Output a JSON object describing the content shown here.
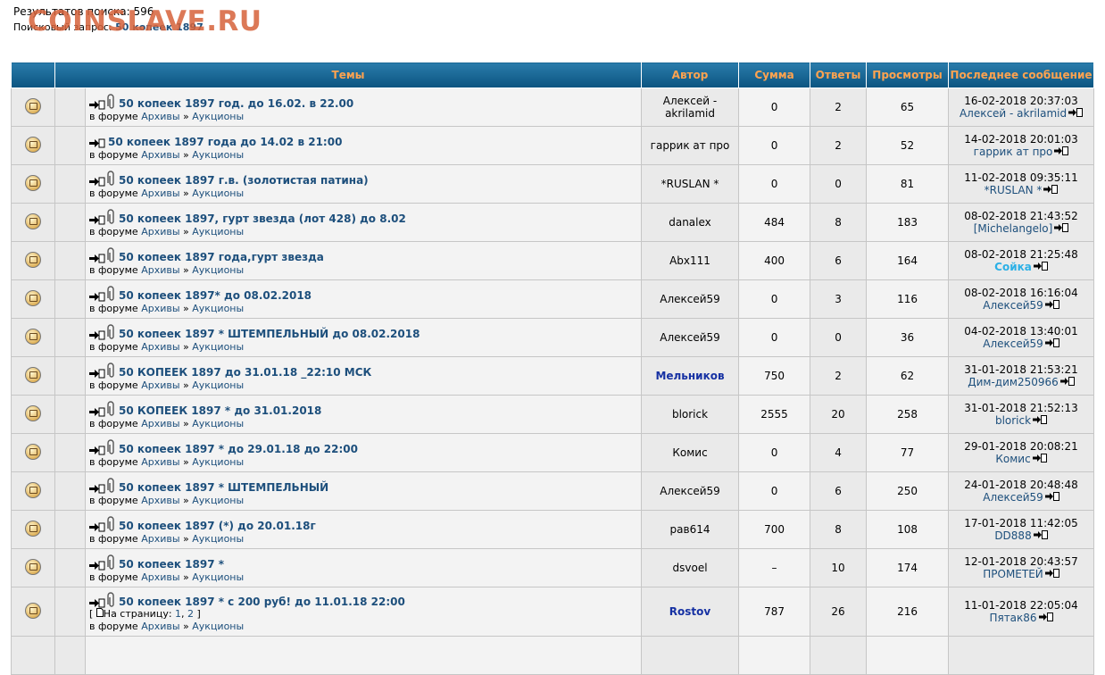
{
  "watermark": "COINSLAVE.RU",
  "results_text": "Результатов поиска: 596",
  "query_label": "Поисковый запрос:",
  "query_value": "50 копеек 1897",
  "columns": {
    "topics": "Темы",
    "author": "Автор",
    "sum": "Сумма",
    "replies": "Ответы",
    "views": "Просмотры",
    "last_post": "Последнее сообщение"
  },
  "forum_prefix": "в форуме",
  "forum_sep": "»",
  "pages_label": "На страницу:",
  "rows": [
    {
      "title": "50 копеек 1897 год. до 16.02. в 22.00",
      "attach": true,
      "forum": "Архивы",
      "sub": "Аукционы",
      "author": "Алексей - akrilamid",
      "author_style": "normal",
      "sum": "0",
      "replies": "2",
      "views": "65",
      "last_date": "16-02-2018 20:37:03",
      "last_author": "Алексей - akrilamid",
      "last_style": "normal"
    },
    {
      "title": "50 копеек 1897 года до 14.02 в 21:00",
      "attach": false,
      "forum": "Архивы",
      "sub": "Аукционы",
      "author": "гаррик ат про",
      "author_style": "normal",
      "sum": "0",
      "replies": "2",
      "views": "52",
      "last_date": "14-02-2018 20:01:03",
      "last_author": "гаррик ат про",
      "last_style": "normal"
    },
    {
      "title": "50 копеек 1897 г.в. (золотистая патина)",
      "attach": true,
      "forum": "Архивы",
      "sub": "Аукционы",
      "author": "*RUSLAN *",
      "author_style": "normal",
      "sum": "0",
      "replies": "0",
      "views": "81",
      "last_date": "11-02-2018 09:35:11",
      "last_author": "*RUSLAN *",
      "last_style": "normal"
    },
    {
      "title": "50 копеек 1897, гурт звезда (лот 428) до 8.02",
      "attach": true,
      "forum": "Архивы",
      "sub": "Аукционы",
      "author": "danalex",
      "author_style": "normal",
      "sum": "484",
      "replies": "8",
      "views": "183",
      "last_date": "08-02-2018 21:43:52",
      "last_author": "[Michelangelo]",
      "last_style": "normal"
    },
    {
      "title": "50 копеек 1897 года,гурт звезда",
      "attach": true,
      "forum": "Архивы",
      "sub": "Аукционы",
      "author": "Abx111",
      "author_style": "normal",
      "sum": "400",
      "replies": "6",
      "views": "164",
      "last_date": "08-02-2018 21:25:48",
      "last_author": "Сойка",
      "last_style": "special"
    },
    {
      "title": "50 копеек 1897* до 08.02.2018",
      "attach": true,
      "forum": "Архивы",
      "sub": "Аукционы",
      "author": "Алексей59",
      "author_style": "normal",
      "sum": "0",
      "replies": "3",
      "views": "116",
      "last_date": "08-02-2018 16:16:04",
      "last_author": "Алексей59",
      "last_style": "normal"
    },
    {
      "title": "50 копеек 1897 * ШТЕМПЕЛЬНЫЙ до 08.02.2018",
      "attach": true,
      "forum": "Архивы",
      "sub": "Аукционы",
      "author": "Алексей59",
      "author_style": "normal",
      "sum": "0",
      "replies": "0",
      "views": "36",
      "last_date": "04-02-2018 13:40:01",
      "last_author": "Алексей59",
      "last_style": "normal"
    },
    {
      "title": "50 КОПЕЕК 1897 до 31.01.18 _22:10 МСК",
      "attach": true,
      "forum": "Архивы",
      "sub": "Аукционы",
      "author": "Мельников",
      "author_style": "bold",
      "sum": "750",
      "replies": "2",
      "views": "62",
      "last_date": "31-01-2018 21:53:21",
      "last_author": "Дим-дим250966",
      "last_style": "normal"
    },
    {
      "title": "50 КОПЕЕК 1897 * до 31.01.2018",
      "attach": true,
      "forum": "Архивы",
      "sub": "Аукционы",
      "author": "blorick",
      "author_style": "normal",
      "sum": "2555",
      "replies": "20",
      "views": "258",
      "last_date": "31-01-2018 21:52:13",
      "last_author": "blorick",
      "last_style": "normal"
    },
    {
      "title": "50 копеек 1897 * до 29.01.18 до 22:00",
      "attach": true,
      "forum": "Архивы",
      "sub": "Аукционы",
      "author": "Комис",
      "author_style": "normal",
      "sum": "0",
      "replies": "4",
      "views": "77",
      "last_date": "29-01-2018 20:08:21",
      "last_author": "Комис",
      "last_style": "normal"
    },
    {
      "title": "50 копеек 1897 * ШТЕМПЕЛЬНЫЙ",
      "attach": true,
      "forum": "Архивы",
      "sub": "Аукционы",
      "author": "Алексей59",
      "author_style": "normal",
      "sum": "0",
      "replies": "6",
      "views": "250",
      "last_date": "24-01-2018 20:48:48",
      "last_author": "Алексей59",
      "last_style": "normal"
    },
    {
      "title": "50 копеек 1897 (*) до 20.01.18г",
      "attach": true,
      "forum": "Архивы",
      "sub": "Аукционы",
      "author": "рав614",
      "author_style": "normal",
      "sum": "700",
      "replies": "8",
      "views": "108",
      "last_date": "17-01-2018 11:42:05",
      "last_author": "DD888",
      "last_style": "normal"
    },
    {
      "title": "50 копеек 1897 *",
      "attach": true,
      "forum": "Архивы",
      "sub": "Аукционы",
      "author": "dsvoel",
      "author_style": "normal",
      "sum": "–",
      "replies": "10",
      "views": "174",
      "last_date": "12-01-2018 20:43:57",
      "last_author": "ПРОМЕТЕЙ",
      "last_style": "normal"
    },
    {
      "title": "50 копеек 1897 * с 200 руб! до 11.01.18 22:00",
      "attach": true,
      "forum": "Архивы",
      "sub": "Аукционы",
      "author": "Rostov",
      "author_style": "bold",
      "sum": "787",
      "replies": "26",
      "views": "216",
      "last_date": "11-01-2018 22:05:04",
      "last_author": "Пятак86",
      "last_style": "normal",
      "pages": [
        "1",
        "2"
      ]
    }
  ]
}
